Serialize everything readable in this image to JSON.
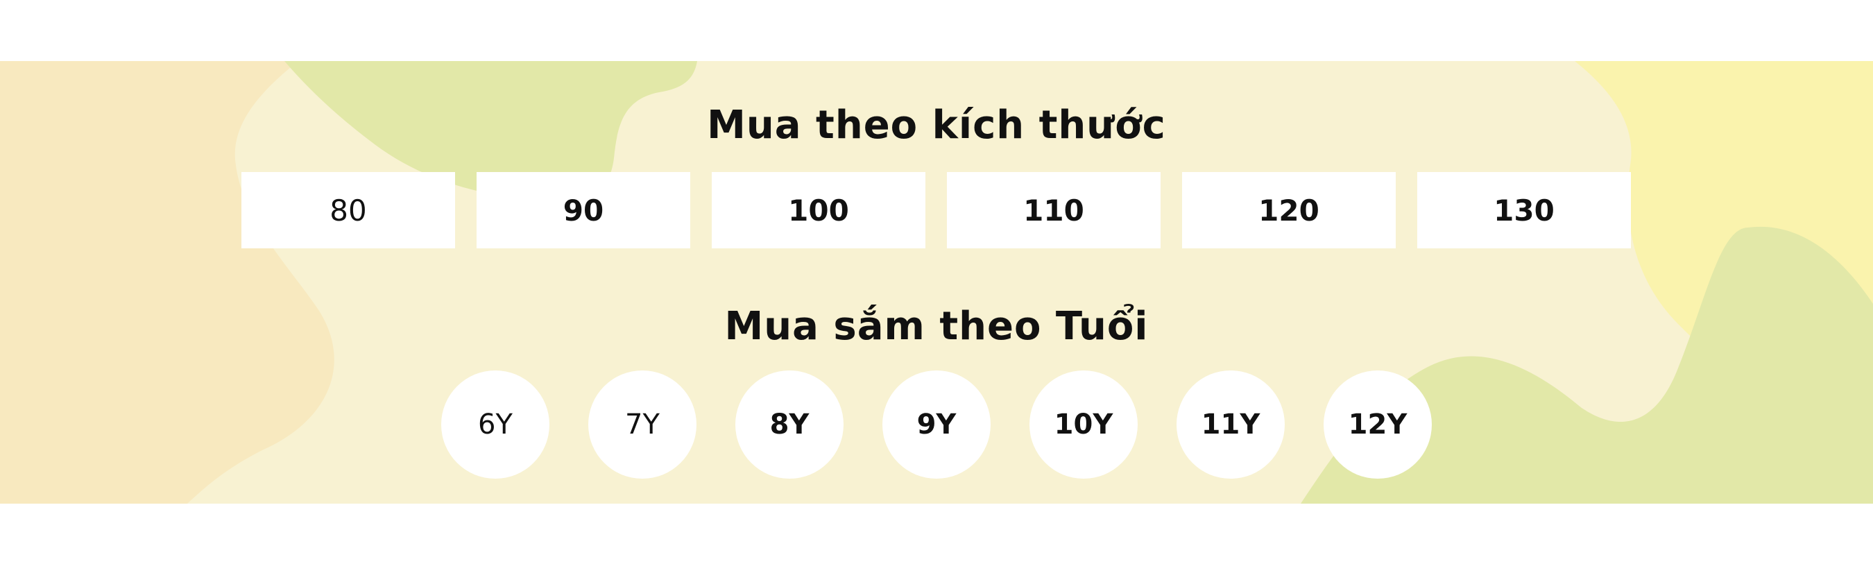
{
  "colors": {
    "background": "#f8f2d2",
    "blob_peach": "#f8e9bf",
    "blob_green": "#e2e8a8",
    "blob_yellow": "#faf3ad",
    "tile": "#ffffff",
    "text": "#111111"
  },
  "size_section": {
    "title": "Mua theo kích thước",
    "options": [
      {
        "label": "80",
        "emphasis": "normal"
      },
      {
        "label": "90",
        "emphasis": "bold"
      },
      {
        "label": "100",
        "emphasis": "bold"
      },
      {
        "label": "110",
        "emphasis": "bold"
      },
      {
        "label": "120",
        "emphasis": "bold"
      },
      {
        "label": "130",
        "emphasis": "bold"
      }
    ]
  },
  "age_section": {
    "title": "Mua sắm theo Tuổi",
    "options": [
      {
        "label": "6Y",
        "emphasis": "normal"
      },
      {
        "label": "7Y",
        "emphasis": "normal"
      },
      {
        "label": "8Y",
        "emphasis": "bold"
      },
      {
        "label": "9Y",
        "emphasis": "bold"
      },
      {
        "label": "10Y",
        "emphasis": "bold"
      },
      {
        "label": "11Y",
        "emphasis": "bold"
      },
      {
        "label": "12Y",
        "emphasis": "bold"
      }
    ]
  }
}
